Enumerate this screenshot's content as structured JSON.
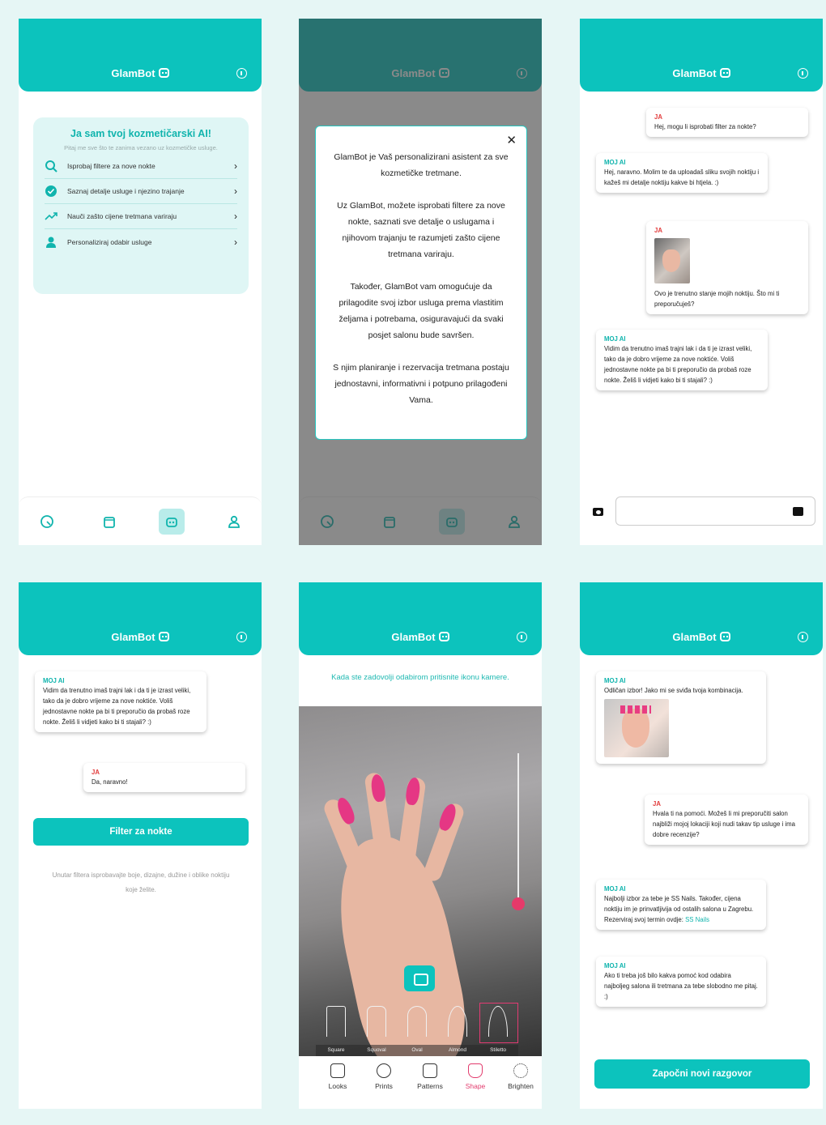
{
  "app": {
    "name": "GlamBot"
  },
  "colors": {
    "accent": "#0cc3bd",
    "me": "#e23b3b",
    "nail": "#e53784"
  },
  "s1": {
    "heading": "Ja sam tvoj kozmetičarski AI!",
    "sub": "Pitaj me sve što te zanima vezano uz kozmetičke usluge.",
    "options": [
      {
        "icon": "search-icon",
        "label": "Isprobaj filtere za nove nokte"
      },
      {
        "icon": "check-badge-icon",
        "label": "Saznaj detalje usluge i njezino trajanje"
      },
      {
        "icon": "trend-icon",
        "label": "Nauči zašto cijene tretmana variraju"
      },
      {
        "icon": "person-icon",
        "label": "Personaliziraj odabir usluge"
      }
    ]
  },
  "s2": {
    "p1": "GlamBot je Vaš personalizirani asistent za sve kozmetičke tretmane.",
    "p2": "Uz GlamBot, možete isprobati filtere za nove nokte, saznati sve detalje o uslugama i njihovom trajanju te razumjeti zašto cijene tretmana variraju.",
    "p3": "Također, GlamBot vam omogućuje da prilagodite svoj izbor usluga prema vlastitim željama i potrebama, osiguravajući da svaki posjet salonu bude savršen.",
    "p4": "S njim planiranje i rezervacija tretmana postaju jednostavni, informativni i potpuno prilagođeni Vama.",
    "close": "✕"
  },
  "labels": {
    "me": "JA",
    "ai": "MOJ AI"
  },
  "s3": {
    "m1": "Hej, mogu li isprobati filter za nokte?",
    "m2": "Hej, naravno. Molim te da uploadaš sliku svojih noktiju i kažeš mi detalje noktiju kakve bi htjela. :)",
    "m3": "Ovo je trenutno stanje mojih noktiju. Što mi ti preporučuješ?",
    "m4": "Vidim da trenutno imaš trajni lak i da ti je izrast veliki, tako da je dobro vrijeme za nove noktiće. Voliš jednostavne nokte pa bi ti preporučio da probaš roze nokte. Želiš li vidjeti kako bi ti stajali? :)"
  },
  "s4": {
    "m1": "Vidim da trenutno imaš trajni lak i da ti je izrast veliki, tako da je dobro vrijeme za nove noktiće. Voliš jednostavne nokte pa bi ti preporučio da probaš roze nokte. Želiš li vidjeti kako bi ti stajali? :)",
    "m2": "Da, naravno!",
    "button": "Filter za nokte",
    "hint": "Unutar filtera isprobavajte boje, dizajne, dužine i oblike noktiju koje želite."
  },
  "s5": {
    "hint": "Kada ste zadovolji odabirom pritisnite ikonu kamere.",
    "shapes": [
      "Square",
      "Squoval",
      "Oval",
      "Almond",
      "Stiletto"
    ],
    "tools": [
      "Looks",
      "Prints",
      "Patterns",
      "Shape",
      "Brighten"
    ],
    "active_tool": "Shape",
    "selected_shape": "Stiletto"
  },
  "s6": {
    "m1": "Odličan izbor! Jako mi se sviđa tvoja kombinacija.",
    "m2": "Hvala ti na pomoći. Možeš li mi preporučiti salon najbliži mojoj lokaciji koji nudi takav tip usluge i ima dobre recenzije?",
    "m3": "Najbolji izbor za tebe je SS Nails. Također, cijena noktiju im je prinvatljivija od ostalih salona u Zagrebu. Rezerviraj svoj termin ovdje:",
    "m3_link": "SS Nails",
    "m4": "Ako ti treba još bilo kakva pomoć kod odabira najboljeg salona ili tretmana za tebe slobodno me pitaj. :)",
    "button": "Započni novi razgovor"
  }
}
